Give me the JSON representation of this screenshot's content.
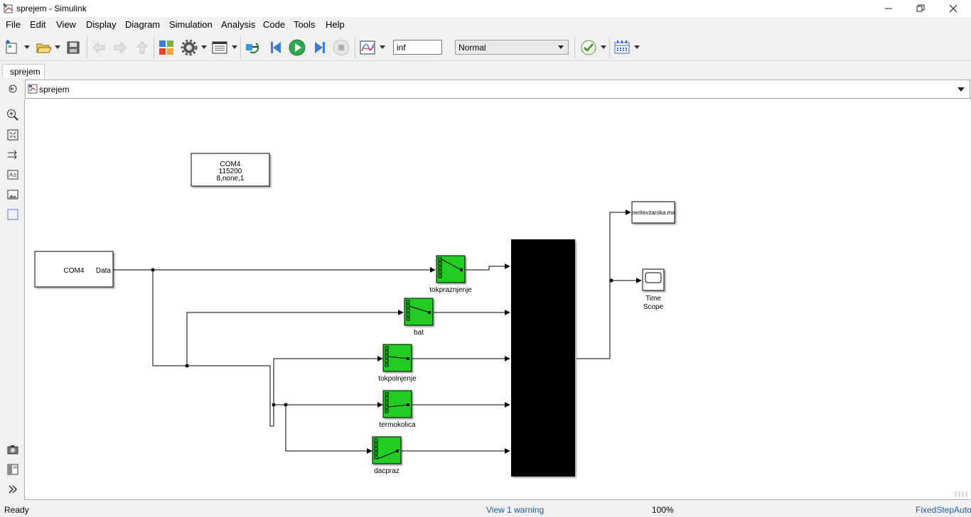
{
  "window": {
    "title": "sprejem - Simulink"
  },
  "menu": [
    "File",
    "Edit",
    "View",
    "Display",
    "Diagram",
    "Simulation",
    "Analysis",
    "Code",
    "Tools",
    "Help"
  ],
  "toolbar": {
    "stop_time": "inf",
    "sim_mode": "Normal",
    "icons": [
      "new-model-icon",
      "open-icon",
      "save-icon",
      "back-icon",
      "forward-icon",
      "up-icon",
      "library-browser-icon",
      "model-config-icon",
      "model-explorer-icon",
      "update-diagram-icon",
      "step-back-icon",
      "run-icon",
      "step-forward-icon",
      "stop-icon",
      "signal-logging-icon",
      "model-advisor-icon",
      "sample-time-icon"
    ]
  },
  "tab": {
    "label": "sprejem"
  },
  "breadcrumb": {
    "label": "sprejem"
  },
  "palette": [
    "hide-browser-icon",
    "zoom-icon",
    "fit-view-icon",
    "signal-routing-icon",
    "annotation-icon",
    "image-icon",
    "area-icon",
    "camera-icon",
    "model-browser-icon",
    "expand-icon"
  ],
  "diagram": {
    "config_block": {
      "line1": "COM4",
      "line2": "115200",
      "line3": "8,none,1"
    },
    "serial_receive": {
      "label": "COM4",
      "port": "Data"
    },
    "selectors": [
      "tokpraznjenje",
      "bat",
      "tokpolnjenje",
      "termokolica",
      "dacpraz"
    ],
    "to_file": {
      "label": "meritevzaroka.mat"
    },
    "scope": {
      "line1": "Time",
      "line2": "Scope"
    },
    "colors": {
      "selector_fill": "#22cc22",
      "mux_fill": "#000000",
      "line": "#000000"
    }
  },
  "status": {
    "state": "Ready",
    "warning": "View 1 warning",
    "zoom": "100%",
    "solver": "FixedStepAuto"
  }
}
